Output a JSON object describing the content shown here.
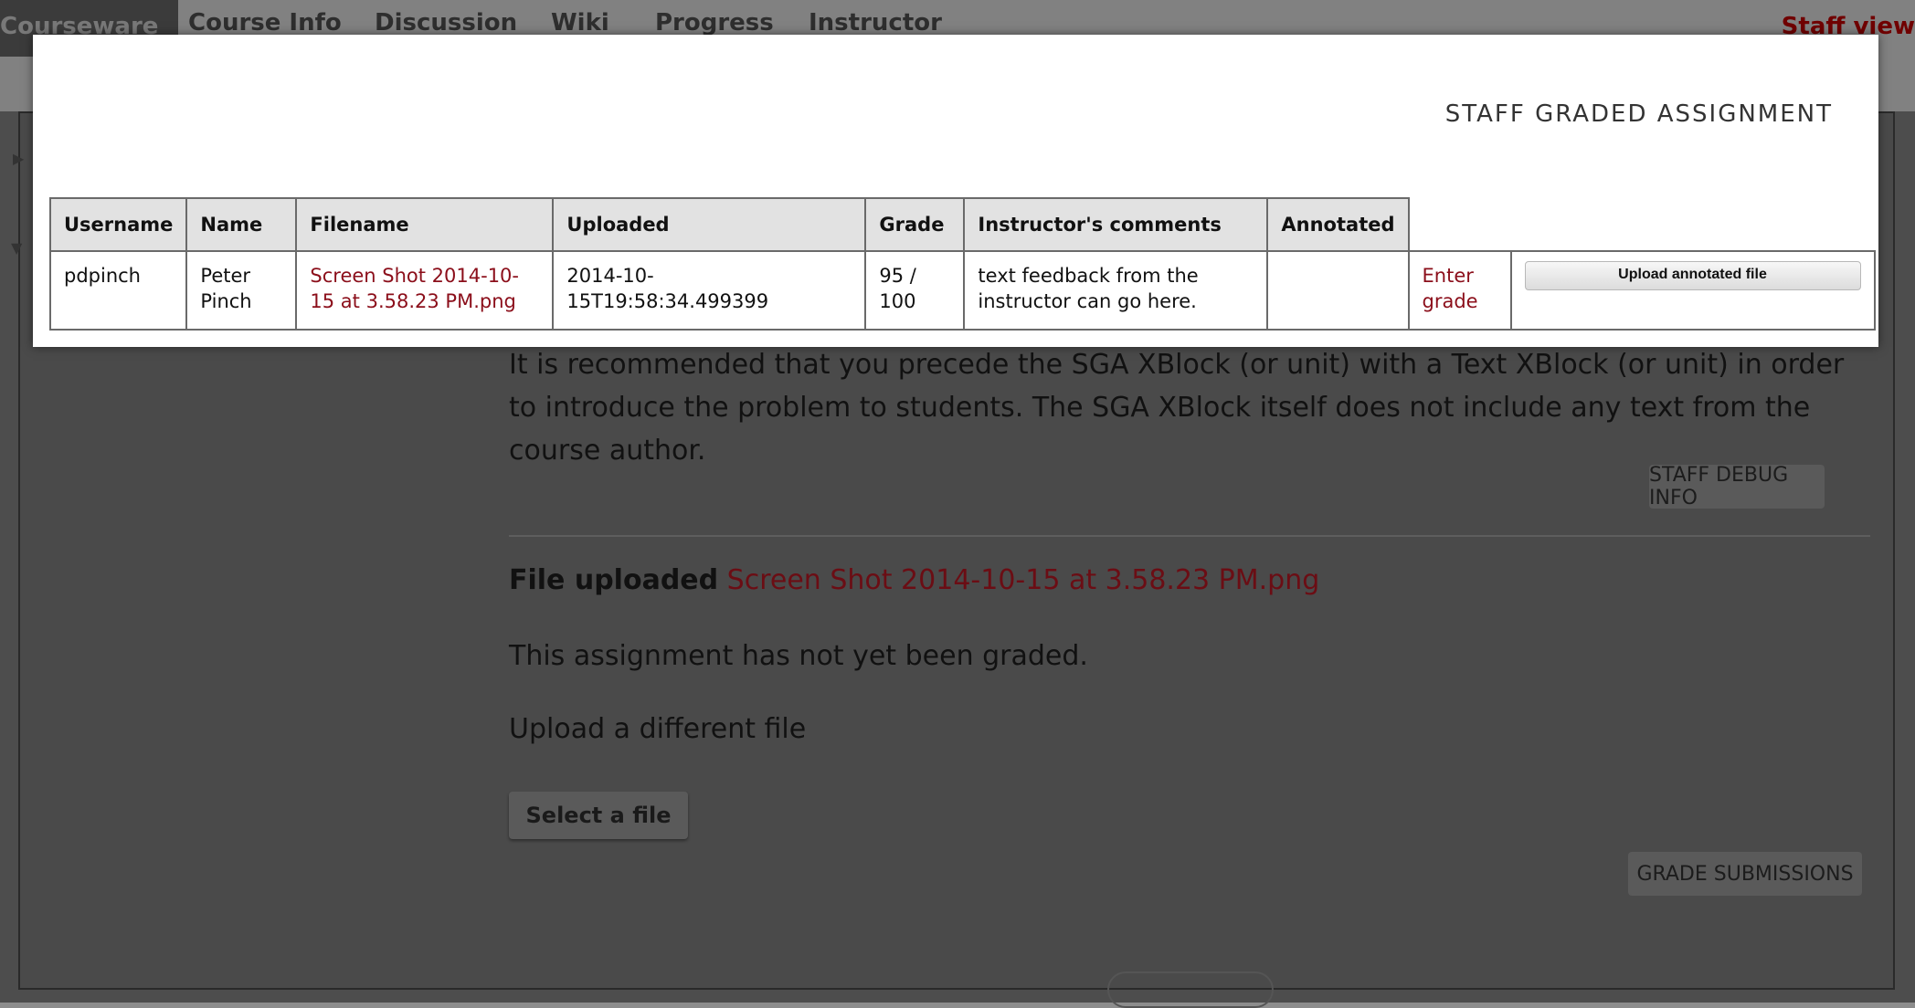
{
  "nav": {
    "tabs": [
      "Courseware",
      "Course Info",
      "Discussion",
      "Wiki",
      "Progress",
      "Instructor"
    ],
    "staff_view": "Staff view"
  },
  "modal": {
    "title": "STAFF GRADED ASSIGNMENT",
    "columns": [
      "Username",
      "Name",
      "Filename",
      "Uploaded",
      "Grade",
      "Instructor's comments",
      "Annotated"
    ],
    "row": {
      "username": "pdpinch",
      "name": "Peter Pinch",
      "filename": "Screen Shot 2014-10-15 at 3.58.23 PM.png",
      "uploaded": "2014-10-15T19:58:34.499399",
      "grade": "95 / 100",
      "comments": "text feedback from the instructor can go here.",
      "annotated": "",
      "enter_grade": "Enter grade",
      "upload_annotated": "Upload annotated file"
    }
  },
  "page": {
    "intro": "It is recommended that you precede the SGA XBlock (or unit) with a Text XBlock (or unit) in order to introduce the problem to students. The SGA XBlock itself does not include any text from the course author.",
    "staff_debug": "STAFF DEBUG INFO",
    "file_uploaded_label": "File uploaded",
    "file_uploaded_name": "Screen Shot 2014-10-15 at 3.58.23 PM.png",
    "not_graded": "This assignment has not yet been graded.",
    "upload_different": "Upload a different file",
    "select_file": "Select a file",
    "grade_submissions": "GRADE SUBMISSIONS"
  },
  "colors": {
    "link": "#8b0e1a",
    "overlay": "#8d8d8d",
    "header_bg": "#e2e2e2"
  }
}
